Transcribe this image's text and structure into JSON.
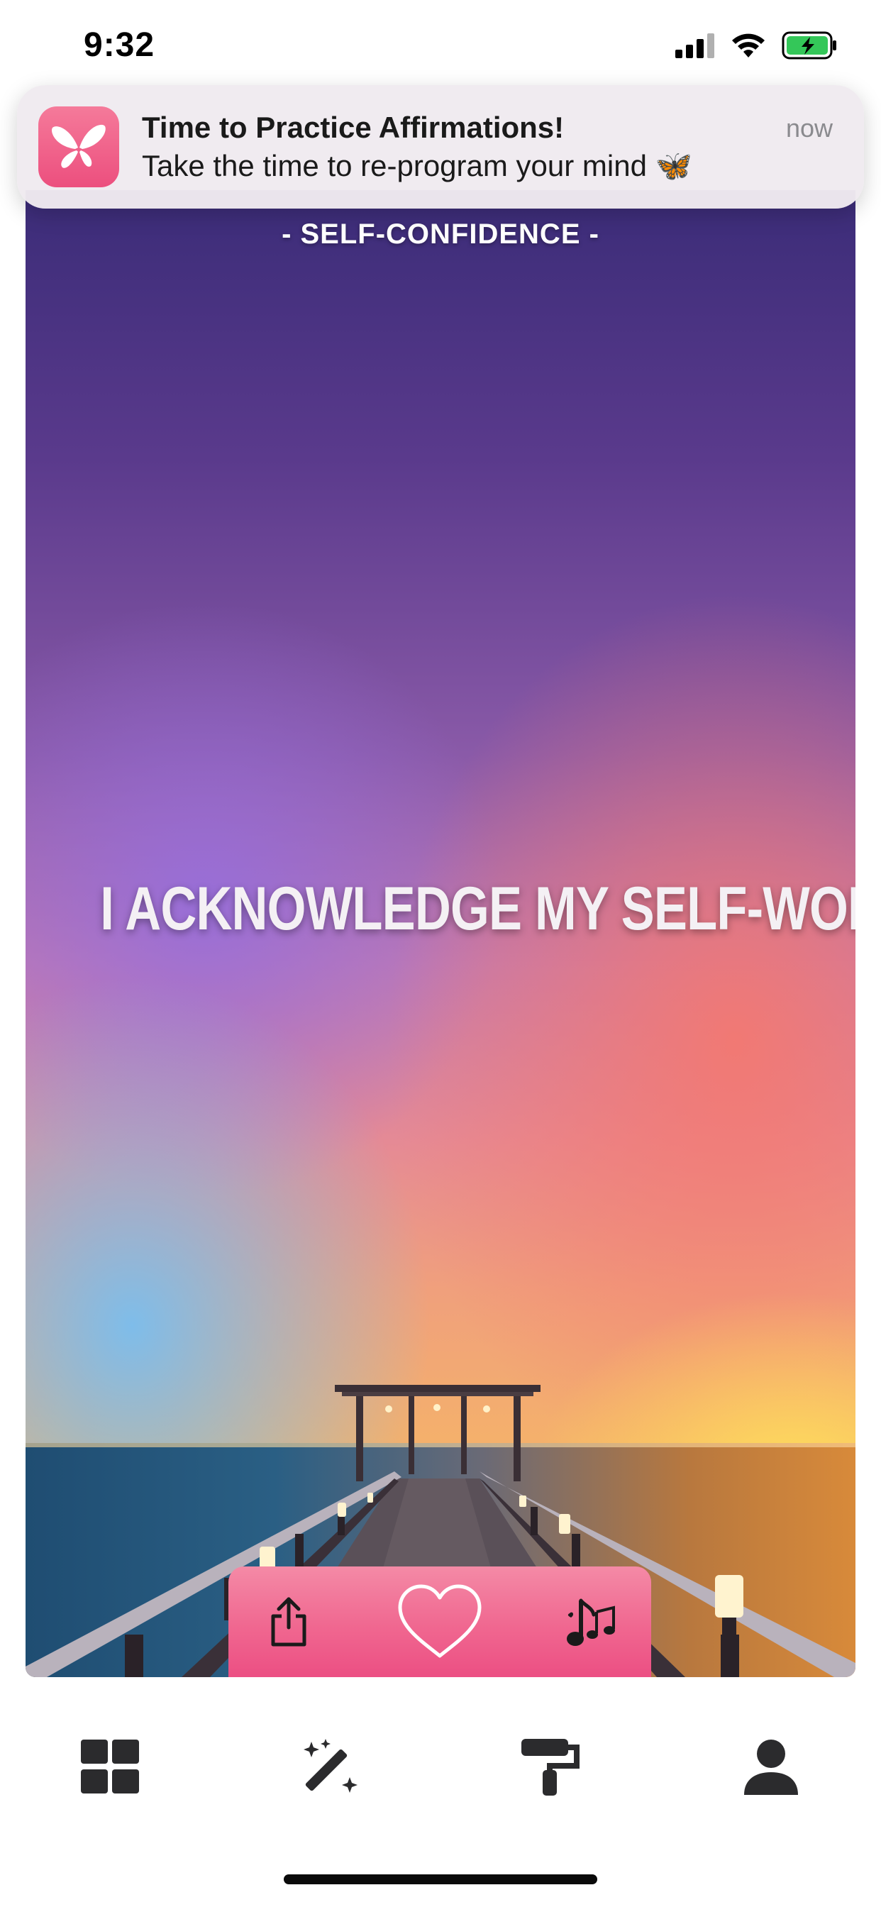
{
  "status_bar": {
    "time": "9:32",
    "icons": [
      "cellular-signal-icon",
      "wifi-icon",
      "battery-charging-icon"
    ]
  },
  "notification": {
    "app_icon": "butterfly-icon",
    "title": "Time to Practice Affirmations!",
    "body": "Take the time to re-program your mind 🦋",
    "time": "now"
  },
  "card": {
    "category": "- SELF-CONFIDENCE -",
    "affirmation": "I ACKNOWLEDGE MY SELF-WORTH.",
    "background": "sunset-pier-wallpaper"
  },
  "action_bar": {
    "buttons": [
      "share-icon",
      "heart-icon",
      "music-icon"
    ]
  },
  "tab_bar": {
    "items": [
      "grid-icon",
      "magic-wand-icon",
      "paint-roller-icon",
      "person-icon"
    ]
  },
  "colors": {
    "accent_pink": "#ec4f83",
    "notification_bg": "#f0eaf0",
    "tab_icon": "#2b2b2d"
  }
}
